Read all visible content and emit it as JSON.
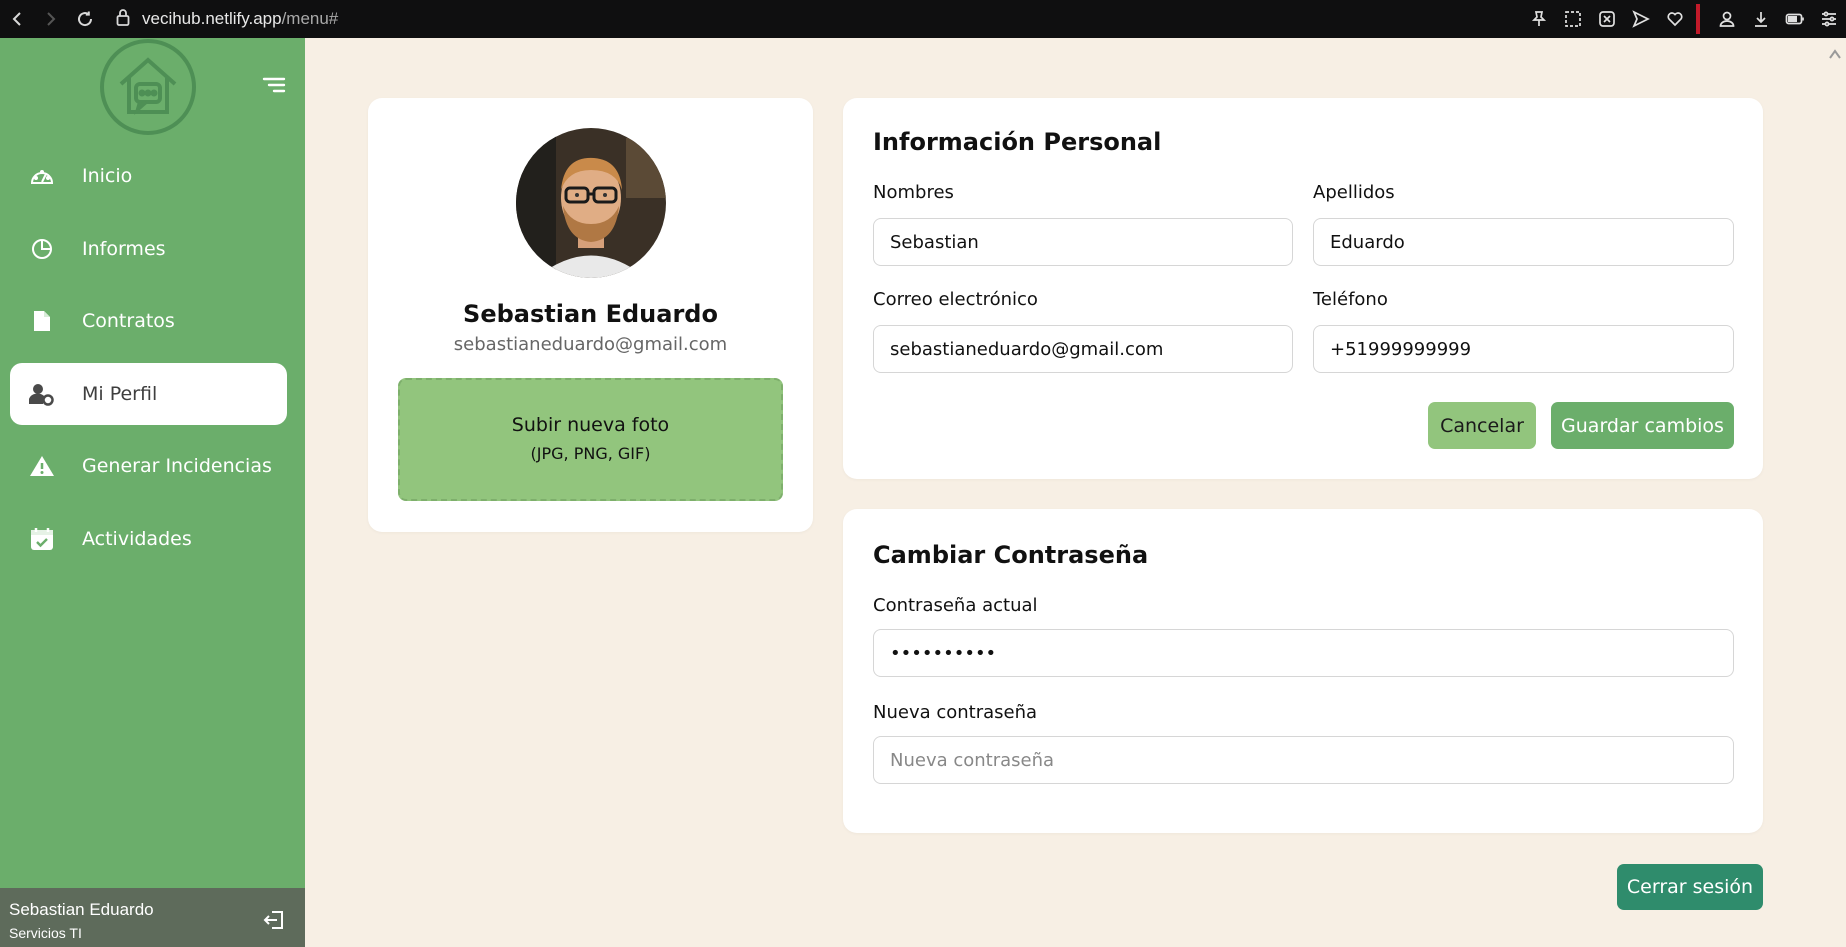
{
  "browser": {
    "url_host": "vecihub.netlify.app",
    "url_path": "/menu#",
    "icons": [
      "back-icon",
      "forward-icon",
      "reload-icon",
      "lock-icon",
      "pin-icon",
      "screenshot-icon",
      "close-box-icon",
      "send-icon",
      "heart-icon",
      "profile-icon",
      "download-icon",
      "battery-icon",
      "settings-icon"
    ]
  },
  "sidebar": {
    "items": [
      {
        "label": "Inicio",
        "icon": "dashboard-icon"
      },
      {
        "label": "Informes",
        "icon": "pie-chart-icon"
      },
      {
        "label": "Contratos",
        "icon": "document-icon"
      },
      {
        "label": "Mi Perfil",
        "icon": "user-gear-icon",
        "active": true
      },
      {
        "label": "Generar Incidencias",
        "icon": "warning-icon"
      },
      {
        "label": "Actividades",
        "icon": "calendar-check-icon"
      }
    ],
    "user": {
      "name": "Sebastian Eduardo",
      "role": "Servicios TI"
    }
  },
  "profile": {
    "name": "Sebastian Eduardo",
    "email": "sebastianeduardo@gmail.com",
    "upload_label": "Subir nueva foto",
    "upload_formats": "(JPG, PNG, GIF)"
  },
  "personal_info": {
    "title": "Información Personal",
    "first_name_label": "Nombres",
    "first_name_value": "Sebastian",
    "last_name_label": "Apellidos",
    "last_name_value": "Eduardo",
    "email_label": "Correo electrónico",
    "email_value": "sebastianeduardo@gmail.com",
    "phone_label": "Teléfono",
    "phone_value": "+51999999999",
    "cancel_label": "Cancelar",
    "save_label": "Guardar cambios"
  },
  "password": {
    "title": "Cambiar Contraseña",
    "current_label": "Contraseña actual",
    "current_value": "••••••••••",
    "new_label": "Nueva contraseña",
    "new_placeholder": "Nueva contraseña"
  },
  "logout_label": "Cerrar sesión",
  "colors": {
    "sidebar": "#6bae6b",
    "background": "#f7efe4",
    "accent_light": "#92c57d",
    "logout": "#2f8c6c"
  }
}
